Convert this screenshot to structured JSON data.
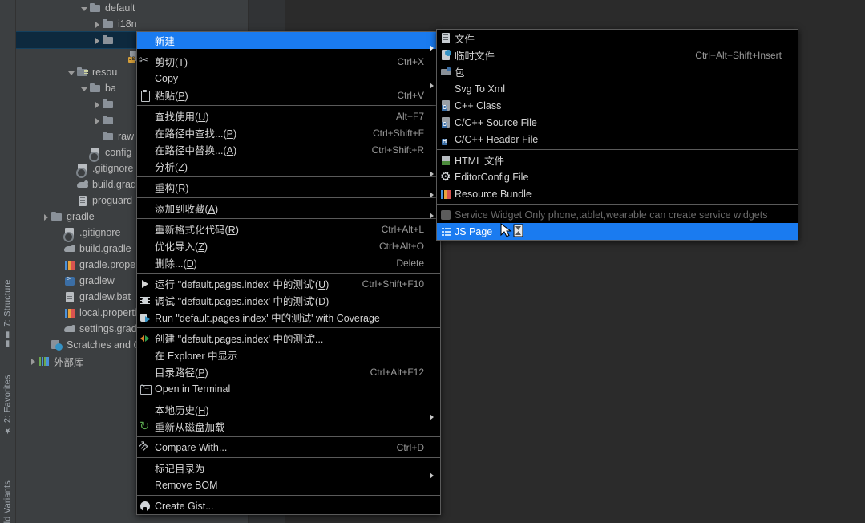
{
  "window": {
    "theme": "darcula",
    "accent_color": "#1a7bf0",
    "menu_bg": "#000000",
    "panel_bg": "#3c3f41",
    "editor_bg": "#2b2b2b",
    "selection_bg": "#0d293e"
  },
  "tool_window_bars": {
    "left": [
      {
        "id": "structure",
        "label": "7: Structure",
        "icon": "structure-icon"
      },
      {
        "id": "favorites",
        "label": "2: Favorites",
        "icon": "star-icon"
      },
      {
        "id": "build-variants",
        "label": "ld Variants",
        "icon": "build-variants-icon"
      }
    ]
  },
  "project_tree": {
    "rows": [
      {
        "indent": 5,
        "arrow": "down",
        "icon": "folder",
        "label": "default",
        "selected": false
      },
      {
        "indent": 6,
        "arrow": "right",
        "icon": "folder",
        "label": "i18n",
        "selected": false
      },
      {
        "indent": 6,
        "arrow": "right",
        "icon": "folder",
        "label": "",
        "selected": true
      },
      {
        "indent": 8,
        "arrow": "none",
        "icon": "jsfile",
        "label": "",
        "selected": false
      },
      {
        "indent": 4,
        "arrow": "down",
        "icon": "res",
        "label": "resou",
        "selected": false
      },
      {
        "indent": 5,
        "arrow": "down",
        "icon": "folder",
        "label": "ba",
        "selected": false
      },
      {
        "indent": 6,
        "arrow": "right",
        "icon": "folder",
        "label": "",
        "selected": false
      },
      {
        "indent": 6,
        "arrow": "right",
        "icon": "folder",
        "label": "",
        "selected": false
      },
      {
        "indent": 6,
        "arrow": "none",
        "icon": "folder",
        "label": "raw",
        "selected": false
      },
      {
        "indent": 5,
        "arrow": "none",
        "icon": "git",
        "label": "config",
        "selected": false
      },
      {
        "indent": 4,
        "arrow": "none",
        "icon": "git",
        "label": ".gitignore",
        "selected": false
      },
      {
        "indent": 4,
        "arrow": "none",
        "icon": "gradle",
        "label": "build.gradle",
        "selected": false
      },
      {
        "indent": 4,
        "arrow": "none",
        "icon": "file",
        "label": "proguard-ru",
        "selected": false
      },
      {
        "indent": 2,
        "arrow": "right",
        "icon": "folder",
        "label": "gradle",
        "selected": false
      },
      {
        "indent": 3,
        "arrow": "none",
        "icon": "git",
        "label": ".gitignore",
        "selected": false
      },
      {
        "indent": 3,
        "arrow": "none",
        "icon": "gradle",
        "label": "build.gradle",
        "selected": false
      },
      {
        "indent": 3,
        "arrow": "none",
        "icon": "props",
        "label": "gradle.properti",
        "selected": false
      },
      {
        "indent": 3,
        "arrow": "none",
        "icon": "term",
        "label": "gradlew",
        "selected": false
      },
      {
        "indent": 3,
        "arrow": "none",
        "icon": "file",
        "label": "gradlew.bat",
        "selected": false
      },
      {
        "indent": 3,
        "arrow": "none",
        "icon": "props",
        "label": "local.properties",
        "selected": false
      },
      {
        "indent": 3,
        "arrow": "none",
        "icon": "gradle",
        "label": "settings.gradle",
        "selected": false
      },
      {
        "indent": 2,
        "arrow": "none",
        "icon": "scratch",
        "label": "Scratches and Cor",
        "selected": false
      },
      {
        "indent": 1,
        "arrow": "right",
        "icon": "lib",
        "label": "外部库",
        "selected": false
      }
    ]
  },
  "context_menu": {
    "items": [
      {
        "label": "新建",
        "accel": "",
        "shortcut": "",
        "icon": "",
        "submenu": true,
        "highlighted": true,
        "disabled": false,
        "sep_after": true
      },
      {
        "label": "剪切",
        "accel": "T",
        "shortcut": "Ctrl+X",
        "icon": "scissors-icon",
        "submenu": false,
        "highlighted": false,
        "disabled": false,
        "sep_after": false
      },
      {
        "label": "Copy",
        "accel": "",
        "shortcut": "",
        "icon": "",
        "submenu": true,
        "highlighted": false,
        "disabled": false,
        "sep_after": false
      },
      {
        "label": "粘贴",
        "accel": "P",
        "shortcut": "Ctrl+V",
        "icon": "paste-icon",
        "submenu": false,
        "highlighted": false,
        "disabled": false,
        "sep_after": true
      },
      {
        "label": "查找使用",
        "accel": "U",
        "shortcut": "Alt+F7",
        "icon": "",
        "submenu": false,
        "highlighted": false,
        "disabled": false,
        "sep_after": false
      },
      {
        "label": "在路径中查找...",
        "accel": "P",
        "shortcut": "Ctrl+Shift+F",
        "icon": "",
        "submenu": false,
        "highlighted": false,
        "disabled": false,
        "sep_after": false
      },
      {
        "label": "在路径中替换...",
        "accel": "A",
        "shortcut": "Ctrl+Shift+R",
        "icon": "",
        "submenu": false,
        "highlighted": false,
        "disabled": false,
        "sep_after": false
      },
      {
        "label": "分析",
        "accel": "Z",
        "shortcut": "",
        "icon": "",
        "submenu": true,
        "highlighted": false,
        "disabled": false,
        "sep_after": true
      },
      {
        "label": "重构",
        "accel": "R",
        "shortcut": "",
        "icon": "",
        "submenu": true,
        "highlighted": false,
        "disabled": false,
        "sep_after": true
      },
      {
        "label": "添加到收藏",
        "accel": "A",
        "shortcut": "",
        "icon": "",
        "submenu": true,
        "highlighted": false,
        "disabled": false,
        "sep_after": true
      },
      {
        "label": "重新格式化代码",
        "accel": "R",
        "shortcut": "Ctrl+Alt+L",
        "icon": "",
        "submenu": false,
        "highlighted": false,
        "disabled": false,
        "sep_after": false
      },
      {
        "label": "优化导入",
        "accel": "Z",
        "shortcut": "Ctrl+Alt+O",
        "icon": "",
        "submenu": false,
        "highlighted": false,
        "disabled": false,
        "sep_after": false
      },
      {
        "label": "删除...",
        "accel": "D",
        "shortcut": "Delete",
        "icon": "",
        "submenu": false,
        "highlighted": false,
        "disabled": false,
        "sep_after": true
      },
      {
        "label": "运行 ''default.pages.index' 中的测试'",
        "accel": "U",
        "shortcut": "Ctrl+Shift+F10",
        "icon": "play-icon",
        "submenu": false,
        "highlighted": false,
        "disabled": false,
        "sep_after": false
      },
      {
        "label": "调试 ''default.pages.index' 中的测试'",
        "accel": "D",
        "shortcut": "",
        "icon": "debug-icon",
        "submenu": false,
        "highlighted": false,
        "disabled": false,
        "sep_after": false
      },
      {
        "label": "Run \"default.pages.index' 中的测试' with Coverage",
        "accel": "",
        "shortcut": "",
        "icon": "coverage-icon",
        "submenu": false,
        "highlighted": false,
        "disabled": false,
        "sep_after": true
      },
      {
        "label": "创建 ''default.pages.index' 中的测试'...",
        "accel": "",
        "shortcut": "",
        "icon": "create-config-icon",
        "submenu": false,
        "highlighted": false,
        "disabled": false,
        "sep_after": false
      },
      {
        "label": "在 Explorer 中显示",
        "accel": "",
        "shortcut": "",
        "icon": "",
        "submenu": false,
        "highlighted": false,
        "disabled": false,
        "sep_after": false
      },
      {
        "label": "目录路径",
        "accel": "P",
        "shortcut": "Ctrl+Alt+F12",
        "icon": "",
        "submenu": false,
        "highlighted": false,
        "disabled": false,
        "sep_after": false
      },
      {
        "label": "Open in Terminal",
        "accel": "",
        "shortcut": "",
        "icon": "terminal-icon",
        "submenu": false,
        "highlighted": false,
        "disabled": false,
        "sep_after": true
      },
      {
        "label": "本地历史",
        "accel": "H",
        "shortcut": "",
        "icon": "",
        "submenu": true,
        "highlighted": false,
        "disabled": false,
        "sep_after": false
      },
      {
        "label": "重新从磁盘加载",
        "accel": "",
        "shortcut": "",
        "icon": "reload-icon",
        "submenu": false,
        "highlighted": false,
        "disabled": false,
        "sep_after": true
      },
      {
        "label": "Compare With...",
        "accel": "",
        "shortcut": "Ctrl+D",
        "icon": "compare-icon",
        "submenu": false,
        "highlighted": false,
        "disabled": false,
        "sep_after": true
      },
      {
        "label": "标记目录为",
        "accel": "",
        "shortcut": "",
        "icon": "",
        "submenu": true,
        "highlighted": false,
        "disabled": false,
        "sep_after": false
      },
      {
        "label": "Remove BOM",
        "accel": "",
        "shortcut": "",
        "icon": "",
        "submenu": false,
        "highlighted": false,
        "disabled": false,
        "sep_after": true
      },
      {
        "label": "Create Gist...",
        "accel": "",
        "shortcut": "",
        "icon": "github-icon",
        "submenu": false,
        "highlighted": false,
        "disabled": false,
        "sep_after": false
      }
    ]
  },
  "new_submenu": {
    "items": [
      {
        "label": "文件",
        "shortcut": "",
        "icon": "doc",
        "highlighted": false,
        "disabled": false,
        "sep_after": false
      },
      {
        "label": "临时文件",
        "shortcut": "Ctrl+Alt+Shift+Insert",
        "icon": "doctmp",
        "highlighted": false,
        "disabled": false,
        "sep_after": false
      },
      {
        "label": "包",
        "shortcut": "",
        "icon": "pkg",
        "highlighted": false,
        "disabled": false,
        "sep_after": false
      },
      {
        "label": "Svg To Xml",
        "shortcut": "",
        "icon": "",
        "highlighted": false,
        "disabled": false,
        "sep_after": false
      },
      {
        "label": "C++ Class",
        "shortcut": "",
        "icon": "cpp",
        "highlighted": false,
        "disabled": false,
        "sep_after": false
      },
      {
        "label": "C/C++ Source File",
        "shortcut": "",
        "icon": "cpp",
        "highlighted": false,
        "disabled": false,
        "sep_after": false
      },
      {
        "label": "C/C++ Header File",
        "shortcut": "",
        "icon": "cpph",
        "highlighted": false,
        "disabled": false,
        "sep_after": true
      },
      {
        "label": "HTML 文件",
        "shortcut": "",
        "icon": "html",
        "highlighted": false,
        "disabled": false,
        "sep_after": false
      },
      {
        "label": "EditorConfig File",
        "shortcut": "",
        "icon": "gear",
        "highlighted": false,
        "disabled": false,
        "sep_after": false
      },
      {
        "label": "Resource Bundle",
        "shortcut": "",
        "icon": "bundle",
        "highlighted": false,
        "disabled": false,
        "sep_after": true
      },
      {
        "label": "Service Widget Only phone,tablet,wearable can create service widgets",
        "shortcut": "",
        "icon": "widget",
        "highlighted": false,
        "disabled": true,
        "sep_after": false
      },
      {
        "label": "JS Page",
        "shortcut": "",
        "icon": "jspage",
        "highlighted": true,
        "disabled": false,
        "sep_after": false
      }
    ]
  },
  "cursor": {
    "state": "busy",
    "icon": "arrow-hourglass-cursor"
  }
}
